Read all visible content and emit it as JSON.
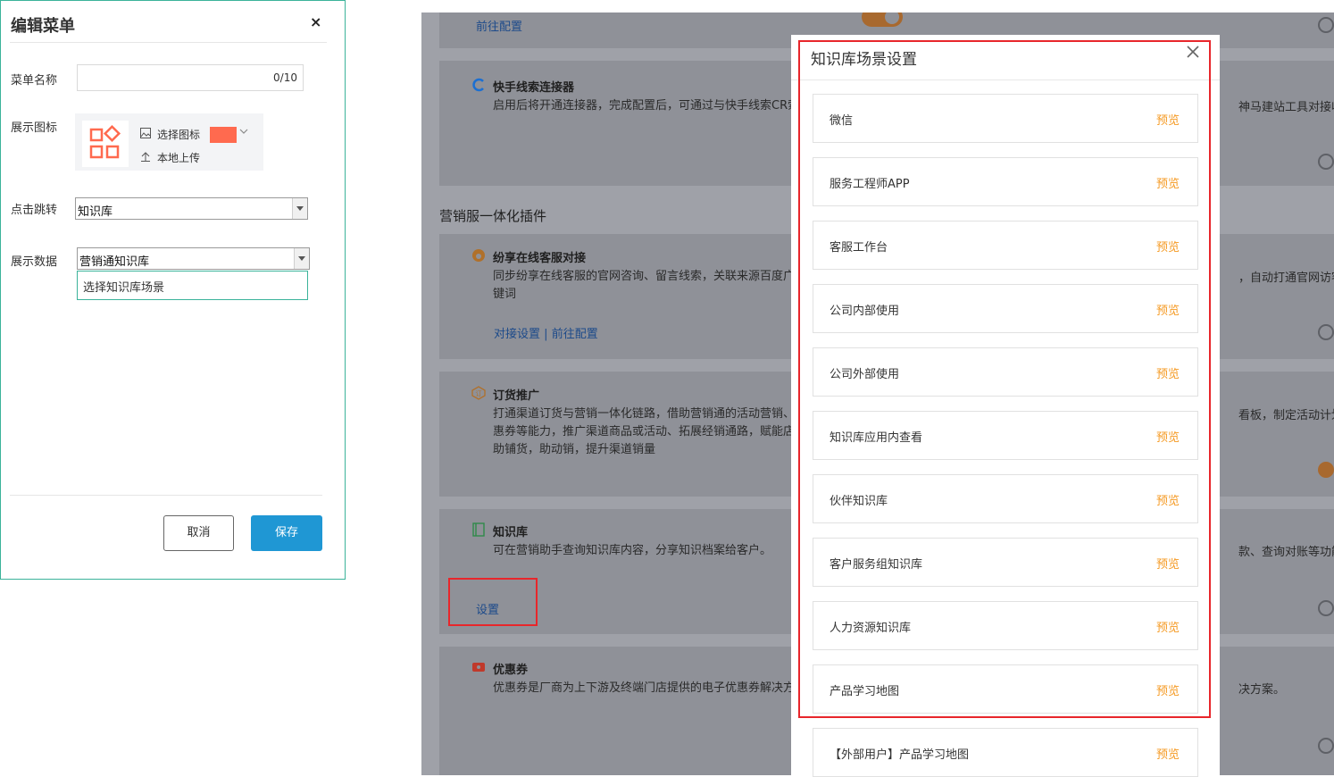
{
  "edit_panel": {
    "title": "编辑菜单",
    "close_glyph": "×",
    "menu_name_label": "菜单名称",
    "menu_name_value": "",
    "menu_name_counter": "0/10",
    "display_icon_label": "展示图标",
    "select_icon_label": "选择图标",
    "local_upload_label": "本地上传",
    "icon_color": "#ff6a4f",
    "click_jump_label": "点击跳转",
    "click_jump_value": "知识库",
    "display_data_label": "展示数据",
    "display_data_value": "营销通知识库",
    "dropdown_option": "选择知识库场景",
    "cancel_label": "取消",
    "save_label": "保存"
  },
  "background_page": {
    "top_link": "前往配置",
    "kuaishou": {
      "title": "快手线索连接器",
      "desc": "启用后将开通连接器，完成配置后，可通过与快手线索CR索。",
      "desc_right": "神马建站工具对接收集"
    },
    "section_heading": "营销服一体化插件",
    "fenxiang": {
      "title": "纷享在线客服对接",
      "desc": "同步纷享在线客服的官网咨询、留言线索，关联来源百度广关键词",
      "desc_right": "，自动打通官网访客与",
      "link_settings": "对接设置",
      "link_separator": "|",
      "link_config": "前往配置"
    },
    "order": {
      "title": "订货推广",
      "desc": "打通渠道订货与营销一体化链路，借助营销通的活动营销、优惠券等能力，推广渠道商品或活动、拓展经销通路，赋能店，助铺货，助动销，提升渠道销量",
      "desc_right": "看板，制定活动计划"
    },
    "knowledge": {
      "title": "知识库",
      "desc": "可在营销助手查询知识库内容，分享知识档案给客户。",
      "desc_right": "款、查询对账等功能",
      "settings_link": "设置"
    },
    "coupon": {
      "title": "优惠券",
      "desc": "优惠券是厂商为上下游及终端门店提供的电子优惠券解决方",
      "desc_right": "决方案。"
    }
  },
  "modal": {
    "title": "知识库场景设置",
    "preview_label": "预览",
    "scenes": [
      "微信",
      "服务工程师APP",
      "客服工作台",
      "公司内部使用",
      "公司外部使用",
      "知识库应用内查看",
      "伙伴知识库",
      "客户服务组知识库",
      "人力资源知识库",
      "产品学习地图",
      "【外部用户】产品学习地图"
    ]
  },
  "colors": {
    "accent_teal": "#3bb39a",
    "save_blue": "#1f97d4",
    "preview_orange": "#f59a23",
    "highlight_red": "#e8262b"
  }
}
